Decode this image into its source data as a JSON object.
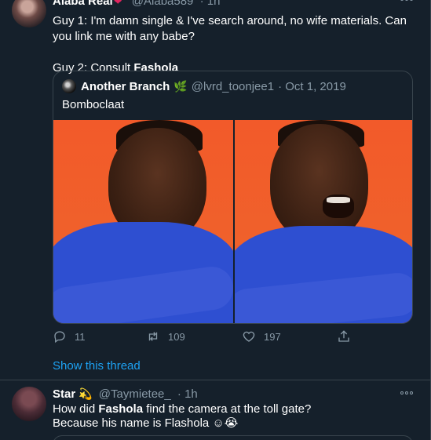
{
  "tweets": [
    {
      "author_name": "Alaba Real",
      "author_emoji": "❤",
      "handle": "@Alaba589",
      "time": "· 1h",
      "text_line1_pre": "Guy 1: I'm damn single & I've search around, no wife materials. Can you link me with any babe?",
      "text_line2_pre": "Guy 2: Consult ",
      "text_line2_bold": "Fashola",
      "quote": {
        "author_name": "Another Branch",
        "author_emoji": "🌿",
        "handle": "@lvrd_toonjee1",
        "date": "· Oct 1, 2019",
        "text": "Bomboclaat"
      },
      "actions": {
        "reply_count": "11",
        "retweet_count": "109",
        "like_count": "197"
      },
      "show_thread": "Show this thread"
    },
    {
      "author_name": "Star",
      "author_emoji": "💫",
      "handle": "@Taymietee_",
      "time": "· 1h",
      "text_line1_pre": "How did ",
      "text_line1_bold": "Fashola",
      "text_line1_post": " find the camera at the toll gate?",
      "text_line2": "Because his name is Flashola ☺😭"
    }
  ],
  "icons": {
    "reply": "reply-icon",
    "retweet": "retweet-icon",
    "like": "heart-icon",
    "share": "share-icon",
    "more": "more-icon"
  },
  "colors": {
    "background": "#15202b",
    "border": "#38444d",
    "secondary_text": "#8899a6",
    "link": "#1da1f2"
  }
}
